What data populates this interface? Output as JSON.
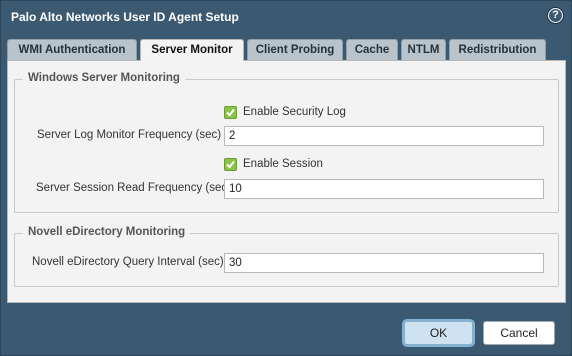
{
  "window": {
    "title": "Palo Alto Networks User ID Agent Setup",
    "help_label": "?"
  },
  "tabs": [
    {
      "label": "WMI Authentication"
    },
    {
      "label": "Server Monitor"
    },
    {
      "label": "Client Probing"
    },
    {
      "label": "Cache"
    },
    {
      "label": "NTLM"
    },
    {
      "label": "Redistribution"
    }
  ],
  "active_tab": "Server Monitor",
  "windows_group": {
    "title": "Windows Server Monitoring",
    "enable_security_log": {
      "label": "Enable Security Log",
      "checked": true
    },
    "log_frequency": {
      "label": "Server Log Monitor Frequency (sec)",
      "value": "2"
    },
    "enable_session": {
      "label": "Enable Session",
      "checked": true
    },
    "session_frequency": {
      "label": "Server Session Read Frequency (sec)",
      "value": "10"
    }
  },
  "novell_group": {
    "title": "Novell eDirectory Monitoring",
    "query_interval": {
      "label": "Novell eDirectory Query Interval (sec)",
      "value": "30"
    }
  },
  "buttons": {
    "ok": "OK",
    "cancel": "Cancel"
  },
  "colors": {
    "titlebar": "#3b5a72",
    "checkbox": "#8bc34a",
    "panel": "#f3f3f3"
  }
}
